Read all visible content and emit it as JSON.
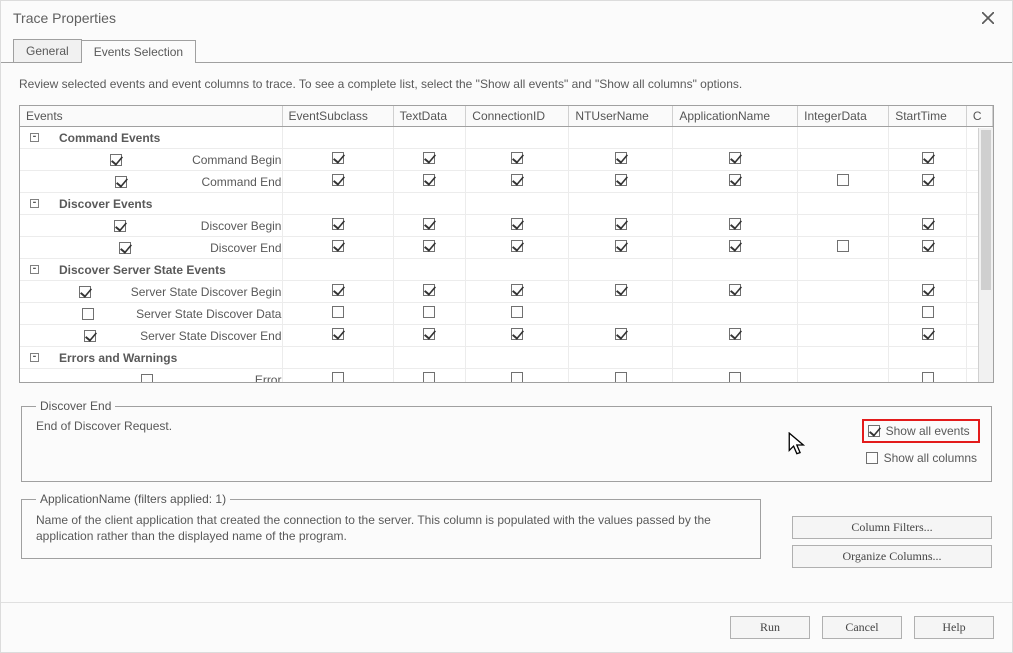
{
  "window": {
    "title": "Trace Properties"
  },
  "tabs": [
    {
      "label": "General"
    },
    {
      "label": "Events Selection"
    }
  ],
  "instructions": "Review selected events and event columns to trace. To see a complete list, select the \"Show all events\" and \"Show all columns\" options.",
  "columns": [
    "Events",
    "EventSubclass",
    "TextData",
    "ConnectionID",
    "NTUserName",
    "ApplicationName",
    "IntegerData",
    "StartTime",
    "C"
  ],
  "groups": [
    {
      "name": "Command Events",
      "expanded": true,
      "rows": [
        {
          "label": "Command Begin",
          "checked": true,
          "cols": {
            "EventSubclass": true,
            "TextData": true,
            "ConnectionID": true,
            "NTUserName": true,
            "ApplicationName": true,
            "IntegerData": null,
            "StartTime": true
          }
        },
        {
          "label": "Command End",
          "checked": true,
          "cols": {
            "EventSubclass": true,
            "TextData": true,
            "ConnectionID": true,
            "NTUserName": true,
            "ApplicationName": true,
            "IntegerData": false,
            "StartTime": true
          }
        }
      ]
    },
    {
      "name": "Discover Events",
      "expanded": true,
      "rows": [
        {
          "label": "Discover Begin",
          "checked": true,
          "cols": {
            "EventSubclass": true,
            "TextData": true,
            "ConnectionID": true,
            "NTUserName": true,
            "ApplicationName": true,
            "IntegerData": null,
            "StartTime": true
          }
        },
        {
          "label": "Discover End",
          "checked": true,
          "cols": {
            "EventSubclass": true,
            "TextData": true,
            "ConnectionID": true,
            "NTUserName": true,
            "ApplicationName": true,
            "IntegerData": false,
            "StartTime": true
          }
        }
      ]
    },
    {
      "name": "Discover Server State Events",
      "expanded": true,
      "rows": [
        {
          "label": "Server State Discover Begin",
          "checked": true,
          "cols": {
            "EventSubclass": true,
            "TextData": true,
            "ConnectionID": true,
            "NTUserName": true,
            "ApplicationName": true,
            "IntegerData": null,
            "StartTime": true
          }
        },
        {
          "label": "Server State Discover Data",
          "checked": false,
          "cols": {
            "EventSubclass": false,
            "TextData": false,
            "ConnectionID": false,
            "NTUserName": null,
            "ApplicationName": null,
            "IntegerData": null,
            "StartTime": false
          }
        },
        {
          "label": "Server State Discover End",
          "checked": true,
          "cols": {
            "EventSubclass": true,
            "TextData": true,
            "ConnectionID": true,
            "NTUserName": true,
            "ApplicationName": true,
            "IntegerData": null,
            "StartTime": true
          }
        }
      ]
    },
    {
      "name": "Errors and Warnings",
      "expanded": true,
      "rows": [
        {
          "label": "Error",
          "checked": false,
          "cols": {
            "EventSubclass": false,
            "TextData": false,
            "ConnectionID": false,
            "NTUserName": false,
            "ApplicationName": false,
            "IntegerData": null,
            "StartTime": false
          }
        }
      ]
    }
  ],
  "detail": {
    "legend": "Discover End",
    "text": "End of Discover Request.",
    "show_all_events": {
      "label": "Show all events",
      "checked": true
    },
    "show_all_columns": {
      "label": "Show all columns",
      "checked": false
    }
  },
  "filters": {
    "legend": "ApplicationName (filters applied: 1)",
    "text": "Name of the client application that created the connection to the server. This column is populated with the values passed by the application rather than the displayed name of the program."
  },
  "buttons": {
    "column_filters": "Column Filters...",
    "organize_columns": "Organize Columns...",
    "run": "Run",
    "cancel": "Cancel",
    "help": "Help"
  }
}
